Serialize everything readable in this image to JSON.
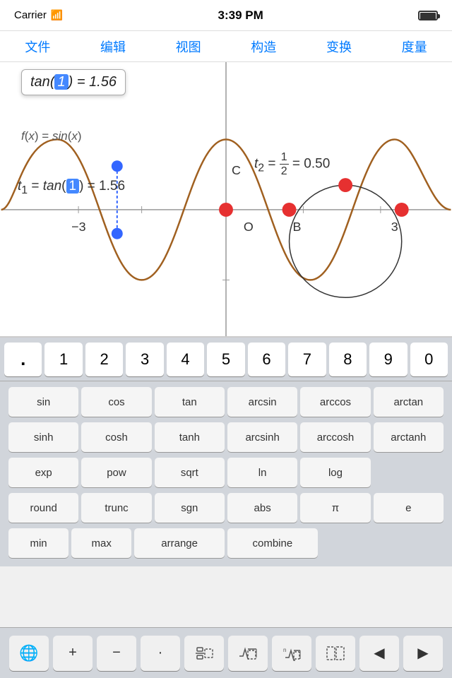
{
  "statusBar": {
    "carrier": "Carrier",
    "time": "3:39 PM"
  },
  "menuBar": {
    "items": [
      "文件",
      "编辑",
      "视图",
      "构造",
      "变换",
      "度量"
    ]
  },
  "graph": {
    "tooltip": {
      "expression": "tan",
      "cursor": "1",
      "equals": "= 1.56"
    },
    "expr1": "f(x) = sin(x)",
    "expr2_label": "t₁",
    "expr2": "= tan(1) = 1.56",
    "expr3_label": "t₂",
    "expr3_num": "1",
    "expr3_den": "2",
    "expr3_val": "= 0.50",
    "labels": {
      "C": "C",
      "O": "O",
      "B": "B",
      "neg3": "−3",
      "pos3": "3"
    }
  },
  "numpad": {
    "keys": [
      ".",
      "1",
      "2",
      "3",
      "4",
      "5",
      "6",
      "7",
      "8",
      "9",
      "0"
    ]
  },
  "funcKeyboard": {
    "rows": [
      [
        "sin",
        "cos",
        "tan",
        "arcsin",
        "arccos",
        "arctan"
      ],
      [
        "sinh",
        "cosh",
        "tanh",
        "arcsinh",
        "arccosh",
        "arctanh"
      ],
      [
        "exp",
        "pow",
        "sqrt",
        "ln",
        "log",
        ""
      ],
      [
        "round",
        "trunc",
        "sgn",
        "abs",
        "π",
        "e"
      ],
      [
        "min",
        "max",
        "arrange",
        "combine",
        "",
        ""
      ]
    ]
  },
  "bottomToolbar": {
    "keys": [
      "globe",
      "+",
      "−",
      "·",
      "fraction",
      "sqrt",
      "nth-root",
      "brackets",
      "prev",
      "next"
    ]
  }
}
